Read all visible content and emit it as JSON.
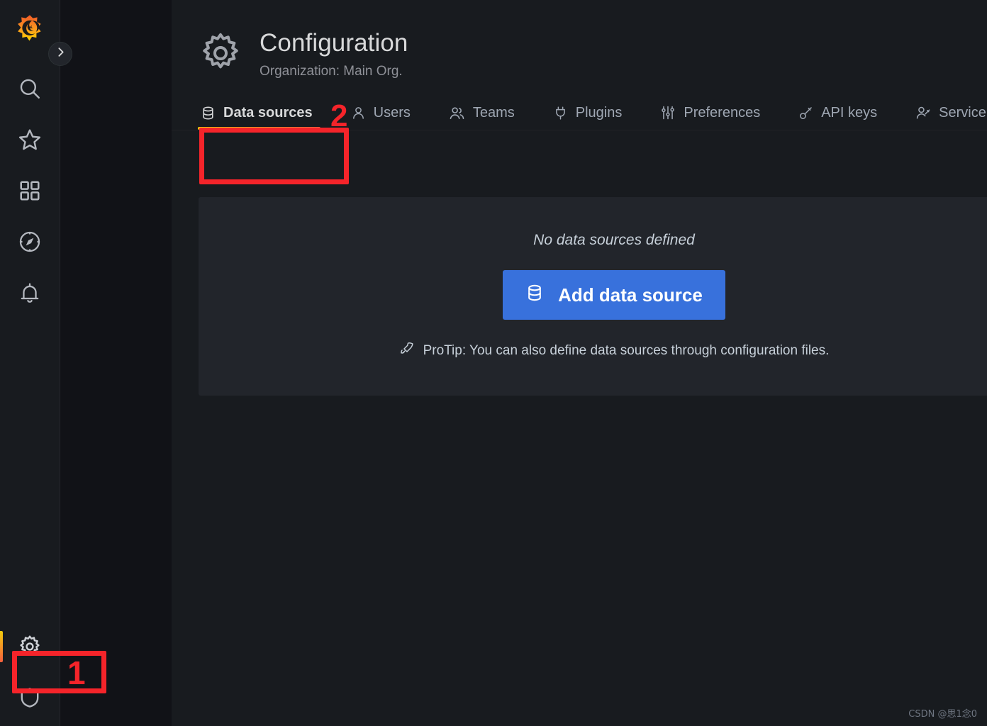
{
  "nav": {
    "logo": "grafana-logo",
    "expand_button": "chevron-right-icon",
    "top_items": [
      {
        "id": "search",
        "icon": "search-icon",
        "label": "Search"
      },
      {
        "id": "starred",
        "icon": "star-icon",
        "label": "Starred"
      },
      {
        "id": "dashboards",
        "icon": "apps-grid-icon",
        "label": "Dashboards"
      },
      {
        "id": "explore",
        "icon": "compass-icon",
        "label": "Explore"
      },
      {
        "id": "alerting",
        "icon": "bell-icon",
        "label": "Alerting"
      }
    ],
    "bottom_items": [
      {
        "id": "configuration",
        "icon": "gear-icon",
        "label": "Configuration",
        "active": true
      },
      {
        "id": "server-admin",
        "icon": "shield-icon",
        "label": "Server Admin"
      }
    ]
  },
  "header": {
    "icon": "gear-icon",
    "title": "Configuration",
    "subtitle": "Organization: Main Org."
  },
  "tabs": [
    {
      "id": "data-sources",
      "label": "Data sources",
      "icon": "database-icon",
      "active": true
    },
    {
      "id": "users",
      "label": "Users",
      "icon": "user-icon",
      "active": false
    },
    {
      "id": "teams",
      "label": "Teams",
      "icon": "users-icon",
      "active": false
    },
    {
      "id": "plugins",
      "label": "Plugins",
      "icon": "plug-icon",
      "active": false
    },
    {
      "id": "preferences",
      "label": "Preferences",
      "icon": "sliders-icon",
      "active": false
    },
    {
      "id": "api-keys",
      "label": "API keys",
      "icon": "key-icon",
      "active": false
    },
    {
      "id": "service-accounts",
      "label": "Service accounts",
      "icon": "user-key-icon",
      "active": false
    }
  ],
  "panel": {
    "empty_message": "No data sources defined",
    "add_button": {
      "label": "Add data source",
      "icon": "database-icon",
      "color": "#3871dc"
    },
    "protip": {
      "icon": "rocket-icon",
      "text": "ProTip: You can also define data sources through configuration files."
    }
  },
  "annotations": [
    {
      "id": "1",
      "number": "1",
      "target": "configuration-nav-item",
      "color": "#f5242a"
    },
    {
      "id": "2",
      "number": "2",
      "target": "data-sources-tab",
      "color": "#f5242a"
    }
  ],
  "watermark": "CSDN @思1念0"
}
